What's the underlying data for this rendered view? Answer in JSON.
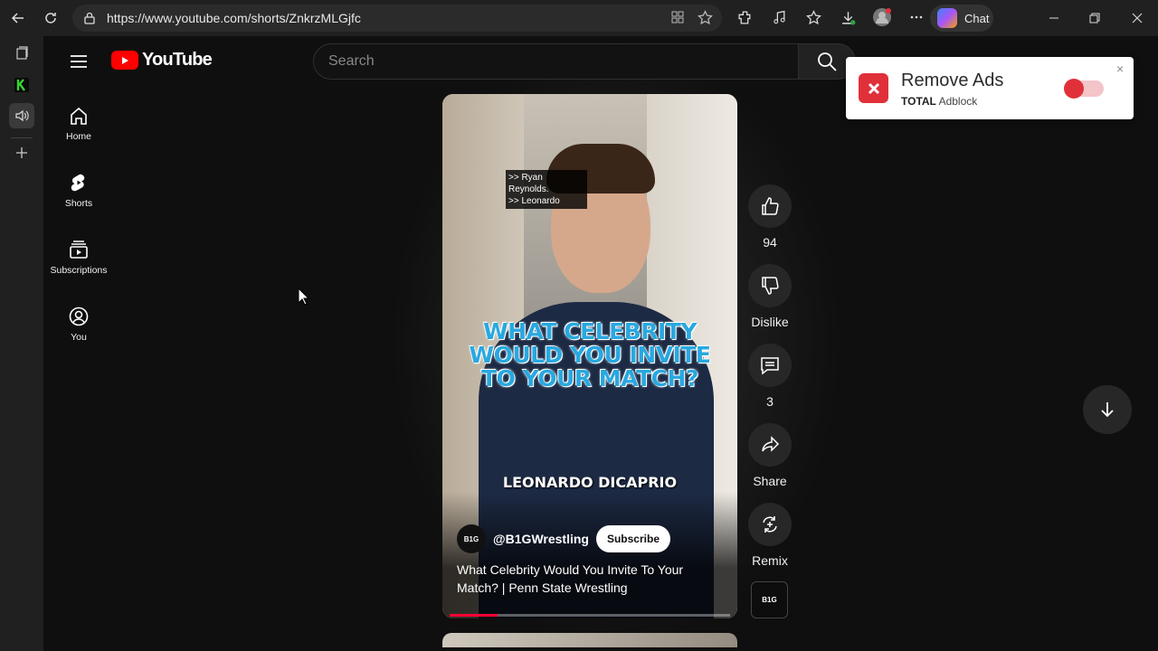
{
  "browser": {
    "url": "https://www.youtube.com/shorts/ZnkrzMLGjfc",
    "chat_label": "Chat"
  },
  "youtube": {
    "logo_text": "YouTube",
    "search_placeholder": "Search",
    "nav": [
      {
        "label": "Home"
      },
      {
        "label": "Shorts"
      },
      {
        "label": "Subscriptions"
      },
      {
        "label": "You"
      }
    ]
  },
  "short": {
    "caption_line1": ">> Ryan Reynolds.",
    "caption_line2": ">> Leonardo",
    "question": "WHAT CELEBRITY WOULD YOU INVITE TO YOUR MATCH?",
    "answer": "LEONARDO DICAPRIO",
    "channel_avatar_text": "B1G",
    "channel_handle": "@B1GWrestling",
    "subscribe_label": "Subscribe",
    "title": "What Celebrity Would You Invite To Your Match? | Penn State Wrestling",
    "progress_fraction": 0.17
  },
  "actions": {
    "likes": "94",
    "dislike_label": "Dislike",
    "comments": "3",
    "share_label": "Share",
    "remix_label": "Remix",
    "audio_thumb_text": "B1G"
  },
  "adblock": {
    "title": "Remove Ads",
    "brand_bold": "TOTAL",
    "brand_rest": " Adblock",
    "close": "×"
  }
}
